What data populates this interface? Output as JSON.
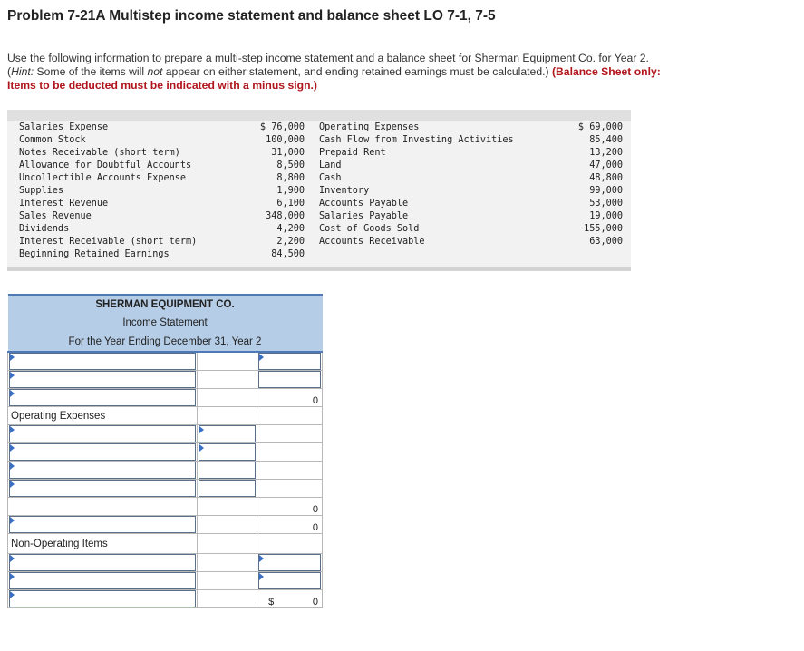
{
  "problem": {
    "title": "Problem 7-21A Multistep income statement and balance sheet LO 7-1, 7-5",
    "intro_line1": "Use the following information to prepare a multi-step income statement and a balance sheet for Sherman Equipment Co. for Year 2.",
    "intro_hint_label": "Hint:",
    "intro_hint_a": " Some of the items will ",
    "intro_hint_not": "not",
    "intro_hint_b": " appear on either statement, and ending retained earnings must be calculated.) ",
    "intro_red_1": "(Balance Sheet only:",
    "intro_red_2": "Items to be deducted must be indicated with a minus sign.)"
  },
  "givens": {
    "left": [
      {
        "label": "Salaries Expense",
        "value": "$ 76,000"
      },
      {
        "label": "Common Stock",
        "value": "100,000"
      },
      {
        "label": "Notes Receivable (short term)",
        "value": "31,000"
      },
      {
        "label": "Allowance for Doubtful Accounts",
        "value": "8,500"
      },
      {
        "label": "Uncollectible Accounts Expense",
        "value": "8,800"
      },
      {
        "label": "Supplies",
        "value": "1,900"
      },
      {
        "label": "Interest Revenue",
        "value": "6,100"
      },
      {
        "label": "Sales Revenue",
        "value": "348,000"
      },
      {
        "label": "Dividends",
        "value": "4,200"
      },
      {
        "label": "Interest Receivable (short term)",
        "value": "2,200"
      },
      {
        "label": "Beginning Retained Earnings",
        "value": "84,500"
      }
    ],
    "right": [
      {
        "label": "Operating Expenses",
        "value": "$ 69,000"
      },
      {
        "label": "Cash Flow from Investing Activities",
        "value": "85,400"
      },
      {
        "label": "Prepaid Rent",
        "value": "13,200"
      },
      {
        "label": "Land",
        "value": "47,000"
      },
      {
        "label": "Cash",
        "value": "48,800"
      },
      {
        "label": "Inventory",
        "value": "99,000"
      },
      {
        "label": "Accounts Payable",
        "value": "53,000"
      },
      {
        "label": "Salaries Payable",
        "value": "19,000"
      },
      {
        "label": "Cost of Goods Sold",
        "value": "155,000"
      },
      {
        "label": "Accounts Receivable",
        "value": "63,000"
      }
    ]
  },
  "income_statement": {
    "company": "SHERMAN EQUIPMENT CO.",
    "statement": "Income Statement",
    "period": "For the Year Ending December 31, Year 2",
    "gross_total": "0",
    "operating_label": "Operating Expenses",
    "op_total": "0",
    "op_income_total": "0",
    "nonop_label": "Non-Operating Items",
    "net_dollar": "$",
    "net_total": "0"
  }
}
